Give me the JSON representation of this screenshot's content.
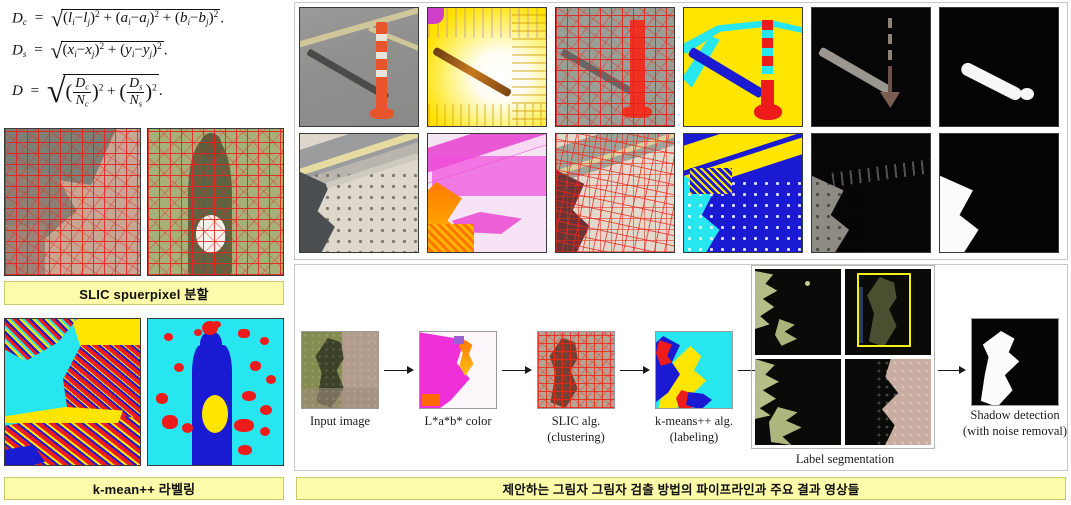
{
  "figure": {
    "title": "Proposed shadow detection pipeline and key result images"
  },
  "formulas": {
    "eq1_label": "D_c = sqrt((l_i - l_j)^2 + (a_i - a_j)^2 + (b_i - b_j)^2).",
    "eq2_label": "D_s = sqrt((x_i - x_j)^2 + (y_i - y_j)^2).",
    "eq3_label": "D = sqrt((D_c/N_c)^2 + (D_s/N_s)^2).",
    "symbols": {
      "Dc": "D",
      "Dc_sub": "c",
      "Ds": "D",
      "Ds_sub": "s",
      "D": "D",
      "l": "l",
      "a": "a",
      "b": "b",
      "x": "x",
      "y": "y",
      "i": "i",
      "j": "j",
      "Nc": "N",
      "Nc_sub": "c",
      "Ns": "N",
      "Ns_sub": "s",
      "two": "2",
      "minus": "−",
      "plus": "+",
      "eq": "=",
      "sqrt": "√",
      "period": ".",
      "lparen": "(",
      "rparen": ")"
    }
  },
  "captions": {
    "slic": "SLIC spuerpixel 분할",
    "kmeans": "k-mean++ 라벨링",
    "pipeline": "제안하는 그림자 그림자 검출 방법의 파이프라인과 주요 결과 영상들"
  },
  "pipeline": {
    "steps": [
      {
        "label_line1": "Input image",
        "label_line2": ""
      },
      {
        "label_line1": "L*a*b* color",
        "label_line2": ""
      },
      {
        "label_line1": "SLIC alg.",
        "label_line2": "(clustering)"
      },
      {
        "label_line1": "k-means++ alg.",
        "label_line2": "(labeling)"
      },
      {
        "label_line1": "Label segmentation",
        "label_line2": ""
      },
      {
        "label_line1": "Shadow detection",
        "label_line2": "(with noise removal)"
      }
    ]
  },
  "result_grid": {
    "row1": [
      {
        "name": "cone-original-photo"
      },
      {
        "name": "cone-lab-color"
      },
      {
        "name": "cone-slic-superpixels"
      },
      {
        "name": "cone-kmeans-labels"
      },
      {
        "name": "cone-label-segmentation"
      },
      {
        "name": "cone-shadow-mask"
      }
    ],
    "row2": [
      {
        "name": "pavement-original-photo"
      },
      {
        "name": "pavement-lab-color"
      },
      {
        "name": "pavement-slic-superpixels"
      },
      {
        "name": "pavement-kmeans-labels"
      },
      {
        "name": "pavement-label-segmentation"
      },
      {
        "name": "pavement-shadow-mask"
      }
    ]
  },
  "left_panel": {
    "slic_images": [
      {
        "name": "slic-pavement-superpixels"
      },
      {
        "name": "slic-cone-superpixels"
      }
    ],
    "kmeans_images": [
      {
        "name": "kmeans-pavement-labels"
      },
      {
        "name": "kmeans-cone-labels"
      }
    ]
  },
  "colors": {
    "caption_fill": "#fbfbaa",
    "caption_border": "#c9c96a",
    "highlight_box": "#f2f215",
    "slic_edge": "#e61e19",
    "label_yellow": "#ffe500",
    "label_cyan": "#28e6ef",
    "label_blue": "#1a1ad2",
    "label_red": "#ee1b1b",
    "arrow": "#1a1a1a",
    "page_bg": "#ffffff"
  }
}
